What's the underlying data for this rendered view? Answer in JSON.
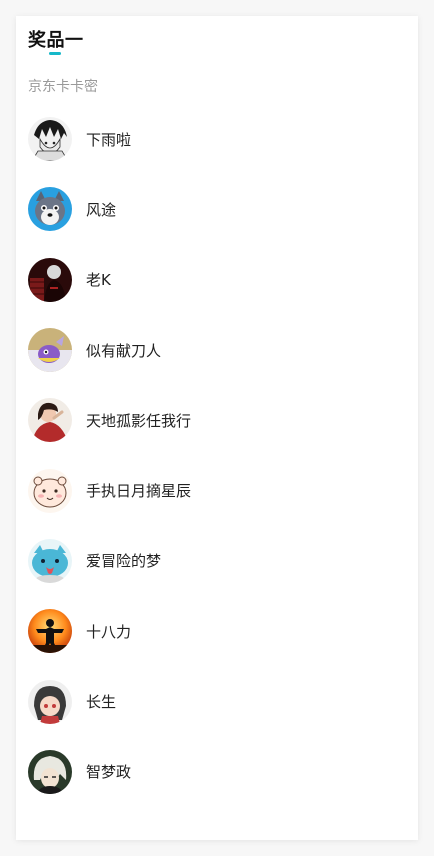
{
  "prize": {
    "title": "奖品一",
    "subtitle": "京东卡卡密",
    "accent_color": "#16b8c9"
  },
  "winners": [
    {
      "name": "下雨啦",
      "avatar": "avatar-anime-boy-sketch"
    },
    {
      "name": "风途",
      "avatar": "avatar-husky-dog"
    },
    {
      "name": "老K",
      "avatar": "avatar-dark-red"
    },
    {
      "name": "似有献刀人",
      "avatar": "avatar-purple-cartoon"
    },
    {
      "name": "天地孤影任我行",
      "avatar": "avatar-red-photo"
    },
    {
      "name": "手执日月摘星辰",
      "avatar": "avatar-cute-bun"
    },
    {
      "name": "爱冒险的梦",
      "avatar": "avatar-blue-cat"
    },
    {
      "name": "十八力",
      "avatar": "avatar-orange-silhouette"
    },
    {
      "name": "长生",
      "avatar": "avatar-anime-girl"
    },
    {
      "name": "智梦政",
      "avatar": "avatar-anime-white-hair"
    }
  ]
}
